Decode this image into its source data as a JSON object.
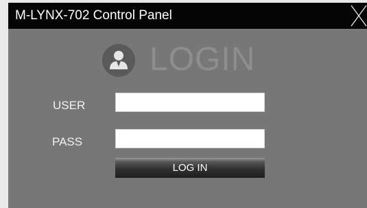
{
  "window": {
    "title": "M-LYNX-702 Control Panel",
    "close_icon": "close-x-icon"
  },
  "login": {
    "heading": "LOGIN",
    "heading_icon": "user-icon",
    "user_label": "USER",
    "user_value": "",
    "pass_label": "PASS",
    "pass_value": "",
    "button_label": "LOG IN"
  },
  "colors": {
    "titlebar": "#050505",
    "panel_background": "#777777",
    "heading_text": "#8e8e8e",
    "label_text": "#f2f2f2",
    "button_dark": "#1e1e1e"
  }
}
